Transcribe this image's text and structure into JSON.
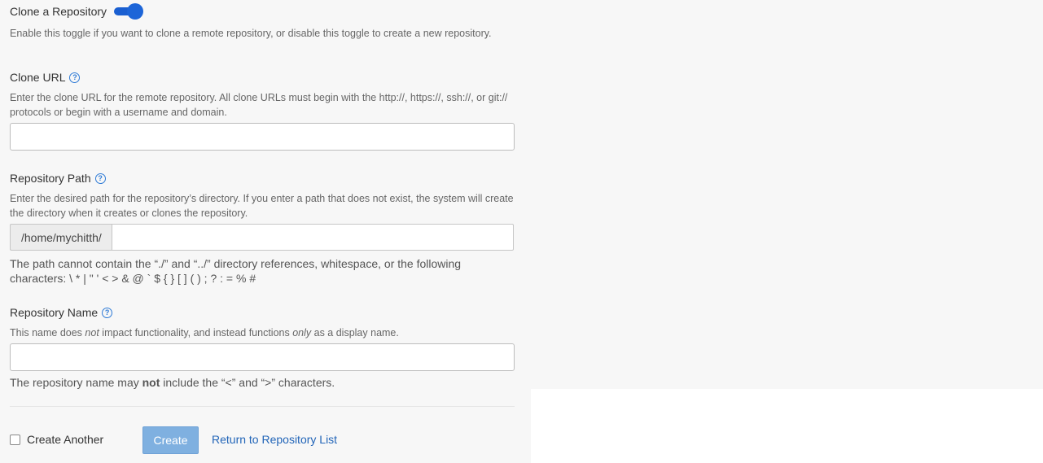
{
  "clone": {
    "label": "Clone a Repository",
    "toggle_on": true,
    "help": "Enable this toggle if you want to clone a remote repository, or disable this toggle to create a new repository."
  },
  "clone_url": {
    "label": "Clone URL",
    "help": "Enter the clone URL for the remote repository. All clone URLs must begin with the http://, https://, ssh://, or git:// protocols or begin with a username and domain.",
    "value": "",
    "placeholder": ""
  },
  "repo_path": {
    "label": "Repository Path",
    "help": "Enter the desired path for the repository’s directory. If you enter a path that does not exist, the system will create the directory when it creates or clones the repository.",
    "prefix": "/home/mychitth/",
    "value": "",
    "note": "The path cannot contain the “./” and “../” directory references, whitespace, or the following characters: \\ * | \" ' < > & @ ` $ { } [ ] ( ) ; ? : = % #"
  },
  "repo_name": {
    "label": "Repository Name",
    "help_before": "This name does ",
    "help_em1": "not",
    "help_mid": " impact functionality, and instead functions ",
    "help_em2": "only",
    "help_after": " as a display name.",
    "value": "",
    "note_before": "The repository name may ",
    "note_bold": "not",
    "note_after": " include the “<” and “>” characters."
  },
  "footer": {
    "create_another_label": "Create Another",
    "create_another_checked": false,
    "create_button": "Create",
    "return_link": "Return to Repository List"
  }
}
